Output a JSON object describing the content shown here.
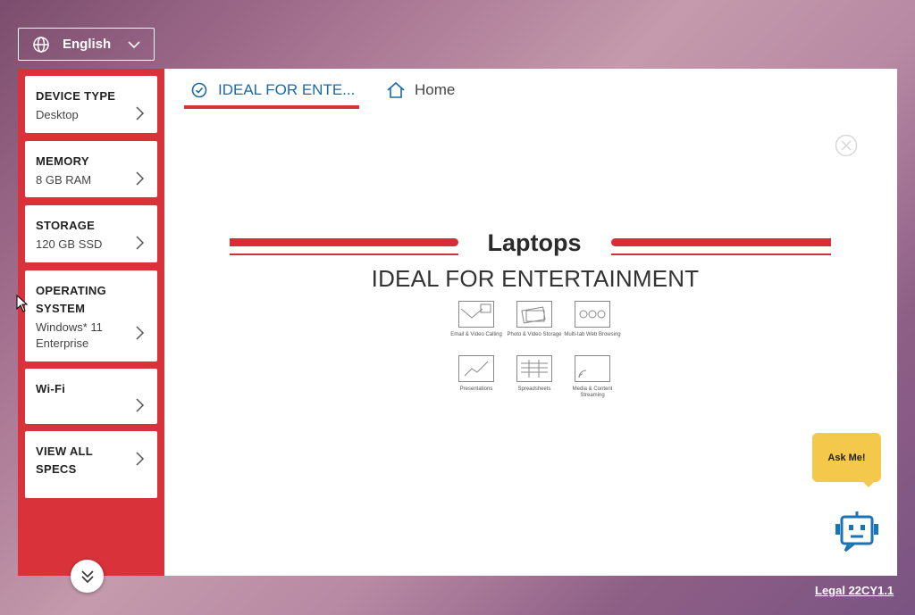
{
  "language": {
    "label": "English"
  },
  "sidebar": {
    "items": [
      {
        "title": "DEVICE TYPE",
        "value": "Desktop"
      },
      {
        "title": "MEMORY",
        "value": "8 GB RAM"
      },
      {
        "title": "STORAGE",
        "value": "120 GB SSD"
      },
      {
        "title": "OPERATING SYSTEM",
        "value": "Windows* 11 Enterprise"
      },
      {
        "title": "Wi-Fi",
        "value": ""
      },
      {
        "title": "VIEW ALL SPECS",
        "value": ""
      }
    ]
  },
  "tabs": [
    {
      "label": "IDEAL FOR ENTE...",
      "icon": "check-circle-icon",
      "active": true
    },
    {
      "label": "Home",
      "icon": "home-icon",
      "active": false
    }
  ],
  "slide": {
    "title": "Laptops",
    "subtitle": "IDEAL FOR ENTERTAINMENT",
    "icons": [
      {
        "label": "Email & Video Calling",
        "icon": "email-video-icon"
      },
      {
        "label": "Photo & Video Storage",
        "icon": "photo-storage-icon"
      },
      {
        "label": "Multi-tab Web Browsing",
        "icon": "browser-tabs-icon"
      },
      {
        "label": "Presentations",
        "icon": "presentation-icon"
      },
      {
        "label": "Spreadsheets",
        "icon": "spreadsheet-icon"
      },
      {
        "label": "Media & Content Streaming",
        "icon": "streaming-icon"
      }
    ]
  },
  "chat": {
    "label": "Ask Me!"
  },
  "footer": {
    "legal": "Legal 22CY1.1"
  },
  "colors": {
    "accent": "#d9323a",
    "link": "#1a6aa5",
    "chat": "#f4c84a",
    "robot": "#1a73b5"
  }
}
